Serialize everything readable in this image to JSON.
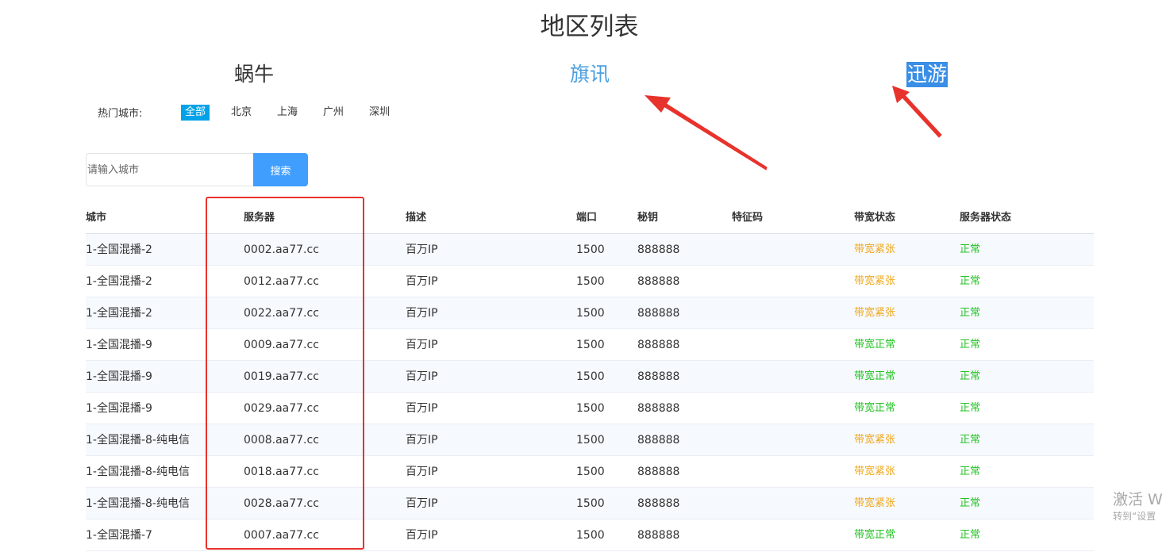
{
  "page_title": "地区列表",
  "providers": [
    {
      "label": "蜗牛"
    },
    {
      "label": "旗讯"
    },
    {
      "label": "迅游"
    }
  ],
  "hot_cities": {
    "label": "热门城市:",
    "items": [
      "全部",
      "北京",
      "上海",
      "广州",
      "深圳"
    ],
    "active": "全部"
  },
  "search": {
    "placeholder": "请输入城市",
    "value": "",
    "button_label": "搜索"
  },
  "table": {
    "headers": [
      "城市",
      "服务器",
      "描述",
      "端口",
      "秘钥",
      "特征码",
      "带宽状态",
      "服务器状态"
    ],
    "rows": [
      {
        "city": "1-全国混播-2",
        "server": "0002.aa77.cc",
        "desc": "百万IP",
        "port": "1500",
        "key": "888888",
        "feature": "",
        "bandwidth": "带宽紧张",
        "status": "正常"
      },
      {
        "city": "1-全国混播-2",
        "server": "0012.aa77.cc",
        "desc": "百万IP",
        "port": "1500",
        "key": "888888",
        "feature": "",
        "bandwidth": "带宽紧张",
        "status": "正常"
      },
      {
        "city": "1-全国混播-2",
        "server": "0022.aa77.cc",
        "desc": "百万IP",
        "port": "1500",
        "key": "888888",
        "feature": "",
        "bandwidth": "带宽紧张",
        "status": "正常"
      },
      {
        "city": "1-全国混播-9",
        "server": "0009.aa77.cc",
        "desc": "百万IP",
        "port": "1500",
        "key": "888888",
        "feature": "",
        "bandwidth": "带宽正常",
        "status": "正常"
      },
      {
        "city": "1-全国混播-9",
        "server": "0019.aa77.cc",
        "desc": "百万IP",
        "port": "1500",
        "key": "888888",
        "feature": "",
        "bandwidth": "带宽正常",
        "status": "正常"
      },
      {
        "city": "1-全国混播-9",
        "server": "0029.aa77.cc",
        "desc": "百万IP",
        "port": "1500",
        "key": "888888",
        "feature": "",
        "bandwidth": "带宽正常",
        "status": "正常"
      },
      {
        "city": "1-全国混播-8-纯电信",
        "server": "0008.aa77.cc",
        "desc": "百万IP",
        "port": "1500",
        "key": "888888",
        "feature": "",
        "bandwidth": "带宽紧张",
        "status": "正常"
      },
      {
        "city": "1-全国混播-8-纯电信",
        "server": "0018.aa77.cc",
        "desc": "百万IP",
        "port": "1500",
        "key": "888888",
        "feature": "",
        "bandwidth": "带宽紧张",
        "status": "正常"
      },
      {
        "city": "1-全国混播-8-纯电信",
        "server": "0028.aa77.cc",
        "desc": "百万IP",
        "port": "1500",
        "key": "888888",
        "feature": "",
        "bandwidth": "带宽紧张",
        "status": "正常"
      },
      {
        "city": "1-全国混播-7",
        "server": "0007.aa77.cc",
        "desc": "百万IP",
        "port": "1500",
        "key": "888888",
        "feature": "",
        "bandwidth": "带宽正常",
        "status": "正常"
      }
    ]
  },
  "status_colors": {
    "带宽紧张": "#f0a81c",
    "带宽正常": "#22c322",
    "正常": "#22c322"
  },
  "annotation_color": "#e8322c",
  "watermark": {
    "line1": "激活 W",
    "line2": "转到“设置"
  }
}
